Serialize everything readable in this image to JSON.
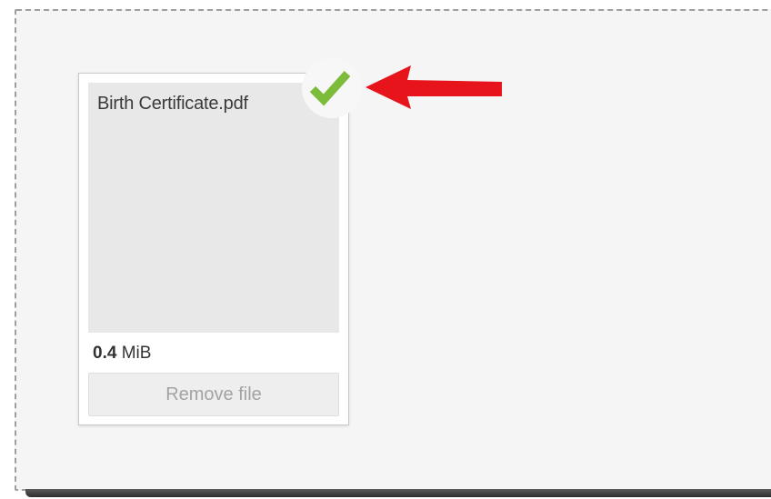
{
  "file": {
    "name": "Birth Certificate.pdf",
    "size_value": "0.4",
    "size_unit": "MiB",
    "remove_label": "Remove file",
    "upload_status": "success"
  },
  "colors": {
    "checkmark": "#7dbb3b",
    "arrow": "#e8141b",
    "dropzone_bg": "#f5f5f5",
    "dropzone_border": "#9e9e9e"
  },
  "icons": {
    "status": "checkmark-icon",
    "annotation": "red-arrow-icon"
  }
}
